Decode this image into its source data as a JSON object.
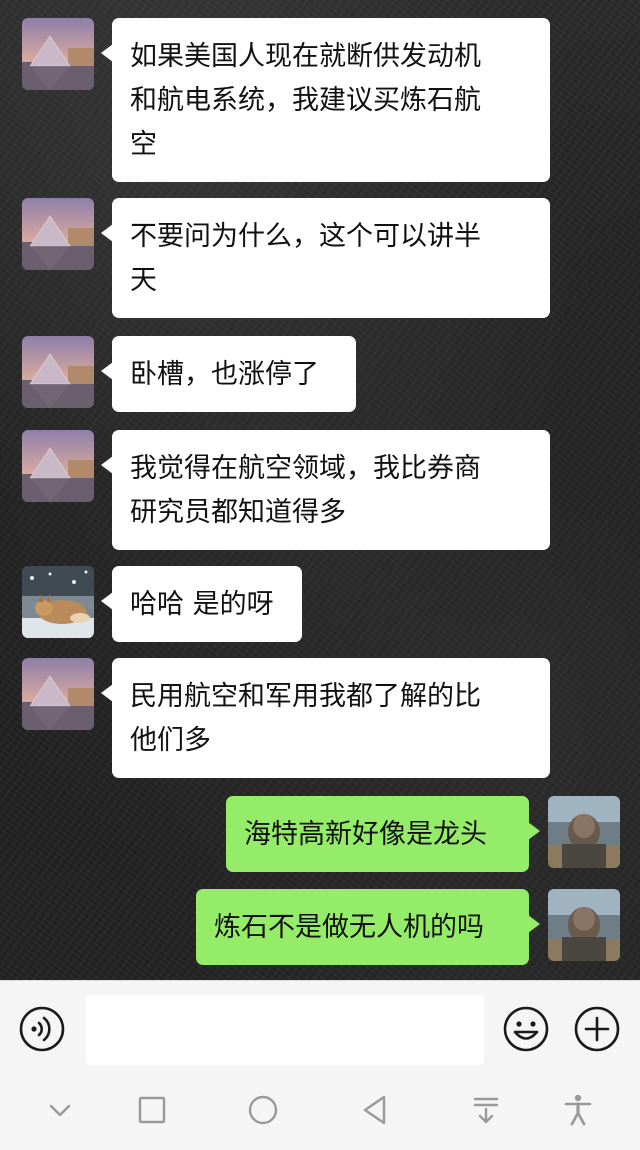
{
  "messages": [
    {
      "side": "in",
      "avatar": "louvre-pyramid-avatar",
      "text": "如果美国人现在就断供发动机\n和航电系统，我建议买炼石航\n空"
    },
    {
      "side": "in",
      "avatar": "louvre-pyramid-avatar",
      "text": "不要问为什么，这个可以讲半\n天"
    },
    {
      "side": "in",
      "avatar": "louvre-pyramid-avatar",
      "text": "卧槽，也涨停了"
    },
    {
      "side": "in",
      "avatar": "louvre-pyramid-avatar",
      "text": "我觉得在航空领域，我比券商\n研究员都知道得多"
    },
    {
      "side": "in",
      "avatar": "fox-in-snow-avatar",
      "text": "哈哈 是的呀"
    },
    {
      "side": "in",
      "avatar": "louvre-pyramid-avatar",
      "text": "民用航空和军用我都了解的比\n他们多"
    },
    {
      "side": "out",
      "avatar": "self-photo-avatar",
      "text": "海特高新好像是龙头"
    },
    {
      "side": "out",
      "avatar": "self-photo-avatar",
      "text": "炼石不是做无人机的吗"
    }
  ],
  "input_bar": {
    "voice_icon": "voice-icon",
    "text_value": "",
    "emoji_icon": "emoji-icon",
    "plus_icon": "plus-icon"
  },
  "nav_bar": {
    "icons": [
      "chevron-down-icon",
      "recents-icon",
      "home-icon",
      "back-icon",
      "pull-down-icon",
      "accessibility-icon"
    ]
  },
  "colors": {
    "incoming_bubble": "#ffffff",
    "outgoing_bubble": "#95ec69",
    "background": "#1e1e1e",
    "input_bar": "#f5f5f5"
  }
}
